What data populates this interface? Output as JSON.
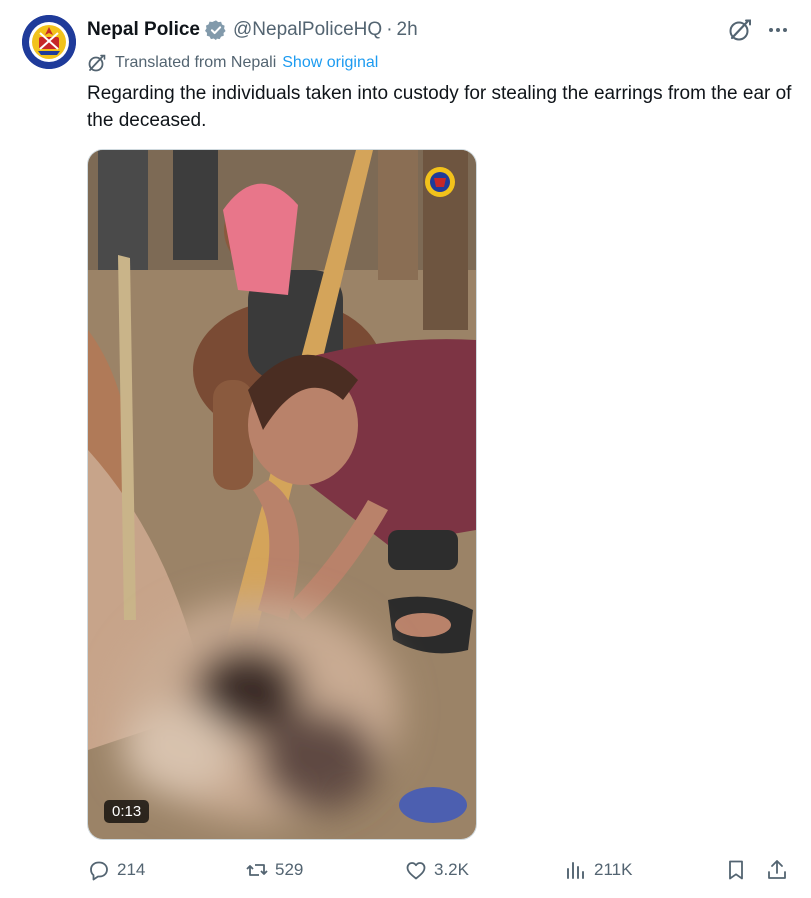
{
  "tweet": {
    "author": {
      "display_name": "Nepal Police",
      "handle": "@NepalPoliceHQ",
      "time": "2h"
    },
    "translation": {
      "label": "Translated from Nepali",
      "show_original": "Show original"
    },
    "text": "Regarding the individuals taken into custody for stealing the earrings from the ear of the deceased.",
    "media": {
      "duration": "0:13",
      "watermark": "Nepal Police emblem"
    },
    "stats": {
      "replies": "214",
      "reposts": "529",
      "likes": "3.2K",
      "views": "211K"
    }
  },
  "icons": {
    "verified": "verified-badge-icon",
    "grok": "grok-icon",
    "more": "more-icon",
    "translate": "translate-icon",
    "reply": "reply-icon",
    "repost": "repost-icon",
    "like": "heart-icon",
    "views": "views-icon",
    "bookmark": "bookmark-icon",
    "share": "share-icon"
  },
  "colors": {
    "link": "#1d9bf0",
    "muted": "#536471",
    "text": "#0f1419",
    "verified": "#829aab",
    "avatar_bg": "#1f3b9a"
  }
}
